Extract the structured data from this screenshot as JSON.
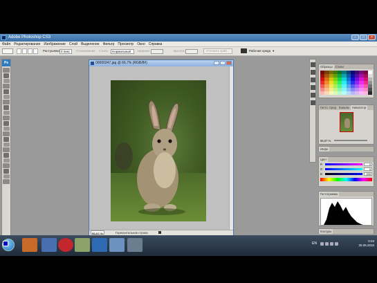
{
  "app": {
    "title": "Adobe Photoshop CS3"
  },
  "menu": [
    "Файл",
    "Редактирование",
    "Изображение",
    "Слой",
    "Выделение",
    "Фильтр",
    "Просмотр",
    "Окно",
    "Справка"
  ],
  "options": {
    "feather_label": "Растушевка:",
    "feather_value": "0 пикс",
    "antialias_label": "Сглаживание",
    "style_label": "Стиль:",
    "style_value": "Нормальный",
    "width_label": "Ширина:",
    "height_label": "Высота:",
    "refine_button": "Уточнить край...",
    "workspace_label": "Рабочая среда"
  },
  "document": {
    "title": "00000247.jpg @ 66,7% (RGB/8#)",
    "zoom": "66,67 %",
    "status_info": "Горизонтальная строка"
  },
  "panels": {
    "swatches_tabs": [
      "Образцы",
      "Стили"
    ],
    "navigator_tabs": [
      "Гисто. Сред",
      "Каналы",
      "Навигатор"
    ],
    "navigator_zoom": "66,67 %",
    "info_tab": "Инфо",
    "color_tab": "Цвет",
    "color_channels": [
      {
        "label": "R",
        "value": "0"
      },
      {
        "label": "G",
        "value": "0"
      },
      {
        "label": "B",
        "value": "255"
      }
    ],
    "histogram_tab": "Гистограмма",
    "contours_tab": "Контуры"
  },
  "taskbar": {
    "lang": "EN",
    "time": "0:23",
    "date": "25.05.2010"
  },
  "colors": {
    "foreground": "#0000cc",
    "background": "#000000",
    "accent": "#3b6ea5"
  }
}
